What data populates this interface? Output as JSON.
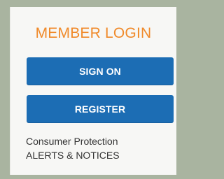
{
  "login_card": {
    "title": "MEMBER LOGIN",
    "sign_on_label": "SIGN ON",
    "register_label": "REGISTER",
    "link_line1": "Consumer Protection",
    "link_line2": "ALERTS & NOTICES"
  },
  "colors": {
    "title_orange": "#f08a2a",
    "button_blue": "#1c6db4",
    "panel_bg": "#f7f7f5",
    "frame_bg": "#a9b4a0",
    "text_dark": "#333333"
  }
}
